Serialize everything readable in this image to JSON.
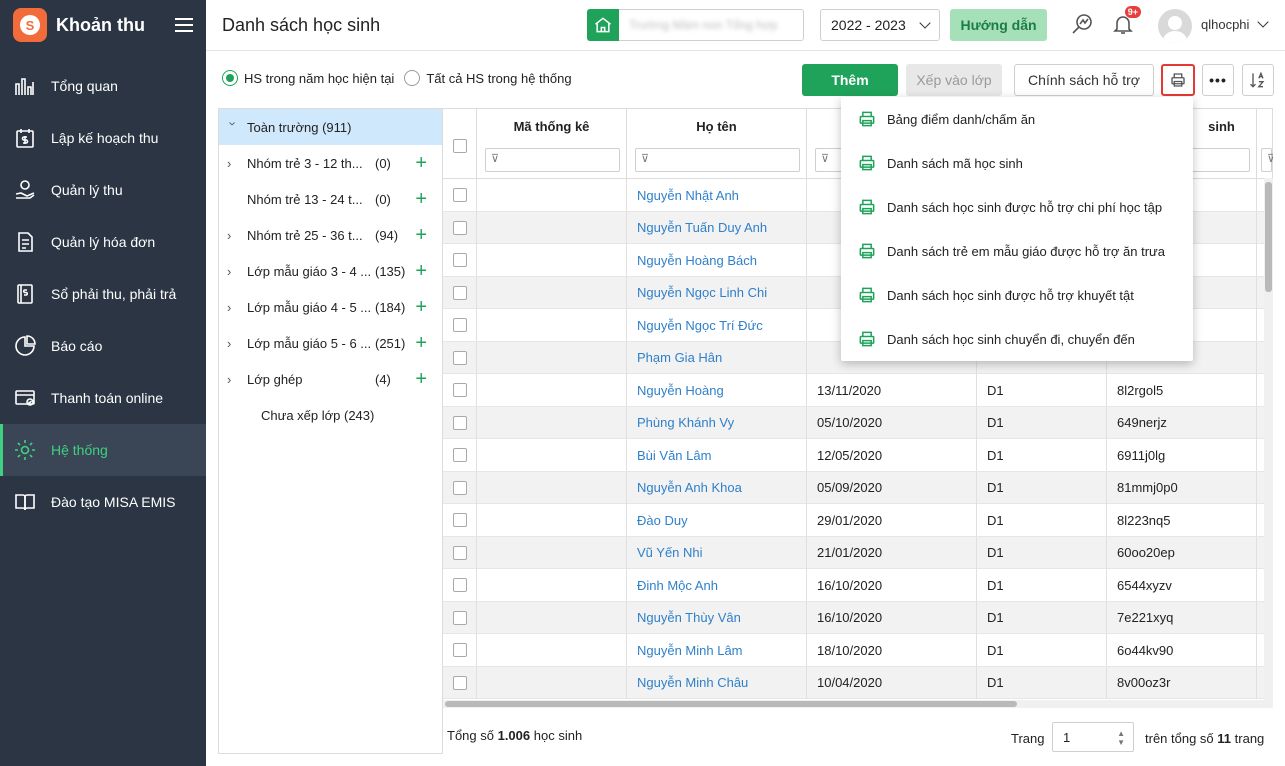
{
  "app": {
    "title": "Khoản thu",
    "logo_letter": "S"
  },
  "sidebar": {
    "items": [
      {
        "label": "Tổng quan",
        "icon": "chart-bars-icon"
      },
      {
        "label": "Lập kế hoạch thu",
        "icon": "calendar-money-icon"
      },
      {
        "label": "Quản lý thu",
        "icon": "hand-coin-icon"
      },
      {
        "label": "Quản lý hóa đơn",
        "icon": "invoice-icon"
      },
      {
        "label": "Sổ phải thu, phải trả",
        "icon": "ledger-icon"
      },
      {
        "label": "Báo cáo",
        "icon": "pie-chart-icon"
      },
      {
        "label": "Thanh toán online",
        "icon": "online-payment-icon"
      },
      {
        "label": "Hệ thống",
        "icon": "gear-icon",
        "active": true
      },
      {
        "label": "Đào tạo MISA EMIS",
        "icon": "book-icon"
      }
    ]
  },
  "header": {
    "page_title": "Danh sách học sinh",
    "school_name": "Trường Mầm non Tổng hợp",
    "year": "2022 - 2023",
    "guide_label": "Hướng dẫn",
    "notification_badge": "9+",
    "username": "qlhocphi"
  },
  "toolbar": {
    "radio_current": "HS trong năm học hiện tại",
    "radio_all": "Tất cả HS trong hệ thống",
    "add_label": "Thêm",
    "assign_label": "Xếp vào lớp",
    "policy_label": "Chính sách hỗ trợ",
    "more_label": "•••"
  },
  "tree": {
    "root": {
      "label": "Toàn trường",
      "count": "(911)"
    },
    "items": [
      {
        "label": "Nhóm trẻ 3 - 12 th...",
        "count": "(0)",
        "expandable": true
      },
      {
        "label": "Nhóm trẻ 13 - 24 t...",
        "count": "(0)",
        "expandable": false
      },
      {
        "label": "Nhóm trẻ 25 - 36 t...",
        "count": "(94)",
        "expandable": true
      },
      {
        "label": "Lớp mẫu giáo 3 - 4 ...",
        "count": "(135)",
        "expandable": true
      },
      {
        "label": "Lớp mẫu giáo 4 - 5 ...",
        "count": "(184)",
        "expandable": true
      },
      {
        "label": "Lớp mẫu giáo 5 - 6 ...",
        "count": "(251)",
        "expandable": true
      },
      {
        "label": "Lớp ghép",
        "count": "(4)",
        "expandable": true
      }
    ],
    "unassigned": "Chưa xếp lớp  (243)"
  },
  "grid": {
    "columns": [
      "Mã thống kê",
      "Họ tên",
      "",
      "",
      "sinh"
    ],
    "rows": [
      {
        "name": "Nguyễn Nhật Anh",
        "dob": "",
        "cls": "",
        "code": ""
      },
      {
        "name": "Nguyễn Tuấn Duy Anh",
        "dob": "",
        "cls": "",
        "code": ""
      },
      {
        "name": "Nguyễn Hoàng Bách",
        "dob": "",
        "cls": "",
        "code": ""
      },
      {
        "name": "Nguyễn Ngọc Linh Chi",
        "dob": "",
        "cls": "",
        "code": ""
      },
      {
        "name": "Nguyễn Ngọc Trí Đức",
        "dob": "",
        "cls": "",
        "code": ""
      },
      {
        "name": "Phạm Gia Hân",
        "dob": "",
        "cls": "",
        "code": ""
      },
      {
        "name": "Nguyễn Hoàng",
        "dob": "13/11/2020",
        "cls": "D1",
        "code": "8l2rgol5"
      },
      {
        "name": "Phùng Khánh Vy",
        "dob": "05/10/2020",
        "cls": "D1",
        "code": "649nerjz"
      },
      {
        "name": "Bùi Văn Lâm",
        "dob": "12/05/2020",
        "cls": "D1",
        "code": "6911j0lg"
      },
      {
        "name": "Nguyễn Anh Khoa",
        "dob": "05/09/2020",
        "cls": "D1",
        "code": "81mmj0p0"
      },
      {
        "name": "Đào Duy",
        "dob": "29/01/2020",
        "cls": "D1",
        "code": "8l223nq5"
      },
      {
        "name": "Vũ Yến Nhi",
        "dob": "21/01/2020",
        "cls": "D1",
        "code": "60oo20ep"
      },
      {
        "name": "Đinh Mộc Anh",
        "dob": "16/10/2020",
        "cls": "D1",
        "code": "6544xyzv"
      },
      {
        "name": "Nguyễn Thùy Vân",
        "dob": "16/10/2020",
        "cls": "D1",
        "code": "7e221xyq"
      },
      {
        "name": "Nguyễn Minh Lâm",
        "dob": "18/10/2020",
        "cls": "D1",
        "code": "6o44kv90"
      },
      {
        "name": "Nguyễn Minh Châu",
        "dob": "10/04/2020",
        "cls": "D1",
        "code": "8v00oz3r"
      }
    ]
  },
  "footer": {
    "total_prefix": "Tổng số ",
    "total_count": "1.006",
    "total_suffix": " học sinh",
    "page_label": "Trang",
    "page_value": "1",
    "of_prefix": "trên tổng số ",
    "of_count": "11",
    "of_suffix": " trang"
  },
  "print_menu": {
    "items": [
      "Bảng điểm danh/chấm ăn",
      "Danh sách mã học sinh",
      "Danh sách học sinh được hỗ trợ chi phí học tập",
      "Danh sách trẻ em mẫu giáo được hỗ trợ ăn trưa",
      "Danh sách học sinh được hỗ trợ khuyết tật",
      "Danh sách học sinh chuyển đi, chuyển đến"
    ]
  },
  "colors": {
    "accent": "#1fa35b",
    "sidebar_bg": "#2b3543",
    "link": "#2f80c9",
    "highlight": "#e53935"
  }
}
